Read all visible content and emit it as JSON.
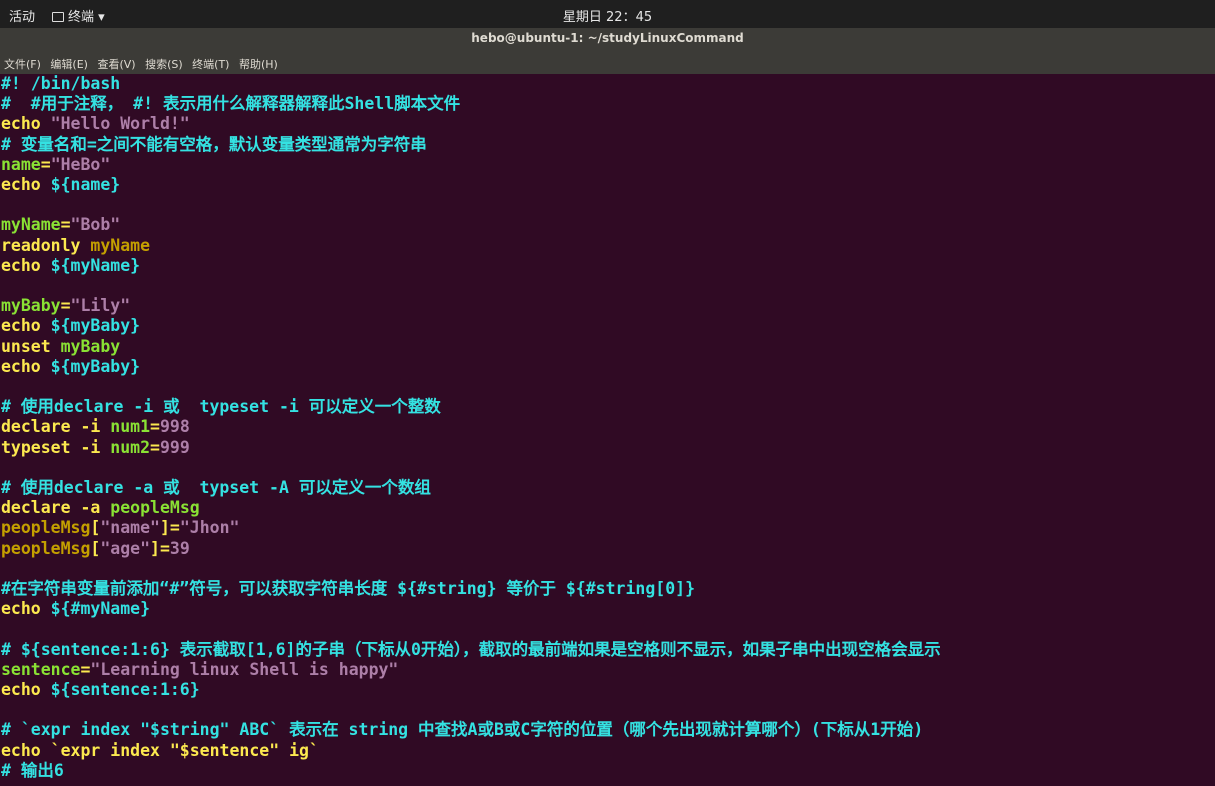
{
  "topbar": {
    "activities": "活动",
    "app_menu": "终端 ▾",
    "clock": "星期日 22：45"
  },
  "window": {
    "title": "hebo@ubuntu-1: ~/studyLinuxCommand"
  },
  "menubar": {
    "items": [
      "文件(F)",
      "编辑(E)",
      "查看(V)",
      "搜索(S)",
      "终端(T)",
      "帮助(H)"
    ]
  },
  "lines": [
    [
      {
        "t": "#! /bin/bash",
        "c": "c"
      }
    ],
    [
      {
        "t": "#  #用于注释， #! 表示用什么解释器解释此Shell脚本文件",
        "c": "c"
      }
    ],
    [
      {
        "t": "echo ",
        "c": "k"
      },
      {
        "t": "\"Hello World!\"",
        "c": "s"
      }
    ],
    [
      {
        "t": "# 变量名和=之间不能有空格，默认变量类型通常为字符串",
        "c": "c"
      }
    ],
    [
      {
        "t": "name",
        "c": "v"
      },
      {
        "t": "=",
        "c": "k"
      },
      {
        "t": "\"HeBo\"",
        "c": "s"
      }
    ],
    [
      {
        "t": "echo ",
        "c": "k"
      },
      {
        "t": "${name}",
        "c": "c"
      }
    ],
    [],
    [
      {
        "t": "myName",
        "c": "v"
      },
      {
        "t": "=",
        "c": "k"
      },
      {
        "t": "\"Bob\"",
        "c": "s"
      }
    ],
    [
      {
        "t": "readonly ",
        "c": "k"
      },
      {
        "t": "myName",
        "c": "o"
      }
    ],
    [
      {
        "t": "echo ",
        "c": "k"
      },
      {
        "t": "${myName}",
        "c": "c"
      }
    ],
    [],
    [
      {
        "t": "myBaby",
        "c": "v"
      },
      {
        "t": "=",
        "c": "k"
      },
      {
        "t": "\"Lily\"",
        "c": "s"
      }
    ],
    [
      {
        "t": "echo ",
        "c": "k"
      },
      {
        "t": "${myBaby}",
        "c": "c"
      }
    ],
    [
      {
        "t": "unset ",
        "c": "k"
      },
      {
        "t": "myBaby",
        "c": "v"
      }
    ],
    [
      {
        "t": "echo ",
        "c": "k"
      },
      {
        "t": "${myBaby}",
        "c": "c"
      }
    ],
    [],
    [
      {
        "t": "# 使用declare -i 或  typeset -i 可以定义一个整数",
        "c": "c"
      }
    ],
    [
      {
        "t": "declare -i ",
        "c": "k"
      },
      {
        "t": "num1",
        "c": "v"
      },
      {
        "t": "=",
        "c": "k"
      },
      {
        "t": "998",
        "c": "n"
      }
    ],
    [
      {
        "t": "typeset -i ",
        "c": "k"
      },
      {
        "t": "num2",
        "c": "v"
      },
      {
        "t": "=",
        "c": "k"
      },
      {
        "t": "999",
        "c": "n"
      }
    ],
    [],
    [
      {
        "t": "# 使用declare -a 或  typset -A 可以定义一个数组",
        "c": "c"
      }
    ],
    [
      {
        "t": "declare -a ",
        "c": "k"
      },
      {
        "t": "peopleMsg",
        "c": "v"
      }
    ],
    [
      {
        "t": "peopleMsg",
        "c": "o"
      },
      {
        "t": "[",
        "c": "k"
      },
      {
        "t": "\"name\"",
        "c": "s"
      },
      {
        "t": "]=",
        "c": "k"
      },
      {
        "t": "\"Jhon\"",
        "c": "s"
      }
    ],
    [
      {
        "t": "peopleMsg",
        "c": "o"
      },
      {
        "t": "[",
        "c": "k"
      },
      {
        "t": "\"age\"",
        "c": "s"
      },
      {
        "t": "]=",
        "c": "k"
      },
      {
        "t": "39",
        "c": "n"
      }
    ],
    [],
    [
      {
        "t": "#在字符串变量前添加“#”符号，可以获取字符串长度 ${#string} 等价于 ${#string[0]}",
        "c": "c"
      }
    ],
    [
      {
        "t": "echo ",
        "c": "k"
      },
      {
        "t": "${#myName}",
        "c": "c"
      }
    ],
    [],
    [
      {
        "t": "# ${sentence:1:6} 表示截取[1,6]的子串（下标从0开始），截取的最前端如果是空格则不显示，如果子串中出现空格会显示",
        "c": "c"
      }
    ],
    [
      {
        "t": "sentence",
        "c": "v"
      },
      {
        "t": "=",
        "c": "k"
      },
      {
        "t": "\"Learning linux Shell is happy\"",
        "c": "s"
      }
    ],
    [
      {
        "t": "echo ",
        "c": "k"
      },
      {
        "t": "${sentence:1:6}",
        "c": "c"
      }
    ],
    [],
    [
      {
        "t": "# `expr index \"$string\" ABC` 表示在 string 中查找A或B或C字符的位置（哪个先出现就计算哪个）(下标从1开始)",
        "c": "c"
      }
    ],
    [
      {
        "t": "echo ",
        "c": "k"
      },
      {
        "t": "`expr index \"$sentence\" ig`",
        "c": "k"
      }
    ],
    [
      {
        "t": "# 输出6",
        "c": "c"
      }
    ]
  ]
}
